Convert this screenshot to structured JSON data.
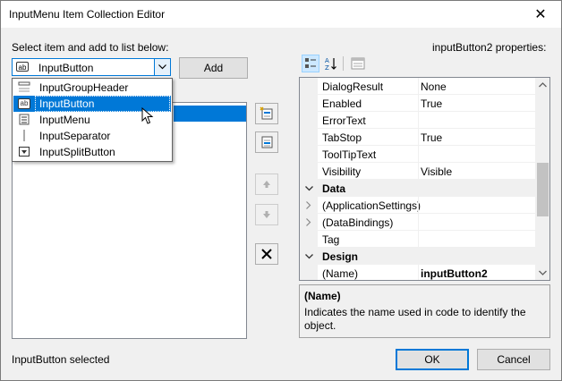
{
  "window": {
    "title": "InputMenu Item Collection Editor"
  },
  "left": {
    "select_label": "Select item and add to list below:",
    "combo_value": "InputButton",
    "add_label": "Add",
    "dropdown": [
      {
        "label": "InputGroupHeader",
        "icon": "group-header-icon"
      },
      {
        "label": "InputButton",
        "icon": "input-button-icon",
        "highlighted": true
      },
      {
        "label": "InputMenu",
        "icon": "input-menu-icon"
      },
      {
        "label": "InputSeparator",
        "icon": "separator-icon"
      },
      {
        "label": "InputSplitButton",
        "icon": "split-button-icon"
      }
    ]
  },
  "right": {
    "properties_label": "inputButton2 properties:",
    "rows": [
      {
        "name": "DialogResult",
        "value": "None"
      },
      {
        "name": "Enabled",
        "value": "True"
      },
      {
        "name": "ErrorText",
        "value": ""
      },
      {
        "name": "TabStop",
        "value": "True"
      },
      {
        "name": "ToolTipText",
        "value": ""
      },
      {
        "name": "Visibility",
        "value": "Visible"
      },
      {
        "name": "Data",
        "category": true
      },
      {
        "name": "(ApplicationSettings)",
        "value": "",
        "expandable": true
      },
      {
        "name": "(DataBindings)",
        "value": "",
        "expandable": true
      },
      {
        "name": "Tag",
        "value": ""
      },
      {
        "name": "Design",
        "category": true
      },
      {
        "name": "(Name)",
        "value": "inputButton2"
      }
    ],
    "desc_title": "(Name)",
    "desc_text": "Indicates the name used in code to identify the object."
  },
  "footer": {
    "status": "InputButton selected",
    "ok_label": "OK",
    "cancel_label": "Cancel"
  },
  "colors": {
    "accent": "#0078d7"
  }
}
